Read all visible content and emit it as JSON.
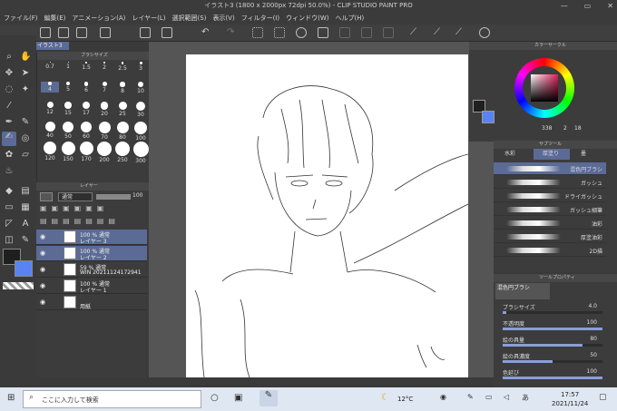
{
  "window": {
    "title": "イラスト3 (1800 x 2000px 72dpi 50.0%) - CLIP STUDIO PAINT PRO",
    "minimize": "—",
    "restore": "▭",
    "close": "✕"
  },
  "menu": [
    "ファイル(F)",
    "編集(E)",
    "アニメーション(A)",
    "レイヤー(L)",
    "選択範囲(S)",
    "表示(V)",
    "フィルター(I)",
    "ウィンドウ(W)",
    "ヘルプ(H)"
  ],
  "doc_tab": "イラスト3",
  "brush_size": {
    "title": "ブラシサイズ",
    "sizes": [
      "0.7",
      "1",
      "1.5",
      "2",
      "2.5",
      "3",
      "4",
      "5",
      "6",
      "7",
      "8",
      "10",
      "12",
      "15",
      "17",
      "20",
      "25",
      "30",
      "40",
      "50",
      "60",
      "70",
      "80",
      "100",
      "120",
      "150",
      "170",
      "200",
      "250",
      "300"
    ],
    "selected": "4"
  },
  "layer": {
    "title": "レイヤー",
    "blend": "通常",
    "opacity": "100",
    "rows": [
      {
        "line1": "100 % 通常",
        "line2": "レイヤー 3",
        "selected": true
      },
      {
        "line1": "100 % 通常",
        "line2": "レイヤー 2",
        "selected": true
      },
      {
        "line1": "59 % 通常",
        "line2": "WIN 20211124172941",
        "selected": false
      },
      {
        "line1": "100 % 通常",
        "line2": "レイヤー 1",
        "selected": false
      },
      {
        "line1": "",
        "line2": "用紙",
        "selected": false
      }
    ]
  },
  "color": {
    "title": "カラーサークル",
    "readout": "338",
    "r": "2",
    "g": "18",
    "main": "#1e2020",
    "sub": "#5a82f2"
  },
  "subtool": {
    "title": "サブツール",
    "tabs": [
      "水彩",
      "厚塗り",
      "墨"
    ],
    "items": [
      "混色円ブラシ",
      "ガッシュ",
      "ドライガッシュ",
      "ガッシュ細筆",
      "油彩",
      "厚塗油彩",
      "2D描"
    ]
  },
  "tool_property": {
    "title": "ツールプロパティ",
    "tool_name": "混色円ブラシ",
    "rows": [
      {
        "label": "ブラシサイズ",
        "value": "4.0",
        "fill": 0.04
      },
      {
        "label": "不透明度",
        "value": "100",
        "fill": 1.0
      },
      {
        "label": "絵の具量",
        "value": "80",
        "fill": 0.8
      },
      {
        "label": "絵の具濃度",
        "value": "50",
        "fill": 0.5
      },
      {
        "label": "色延び",
        "value": "100",
        "fill": 1.0
      }
    ]
  },
  "taskbar": {
    "search_placeholder": "ここに入力して検索",
    "weather": "12°C",
    "time": "17:57",
    "date": "2021/11/24"
  }
}
